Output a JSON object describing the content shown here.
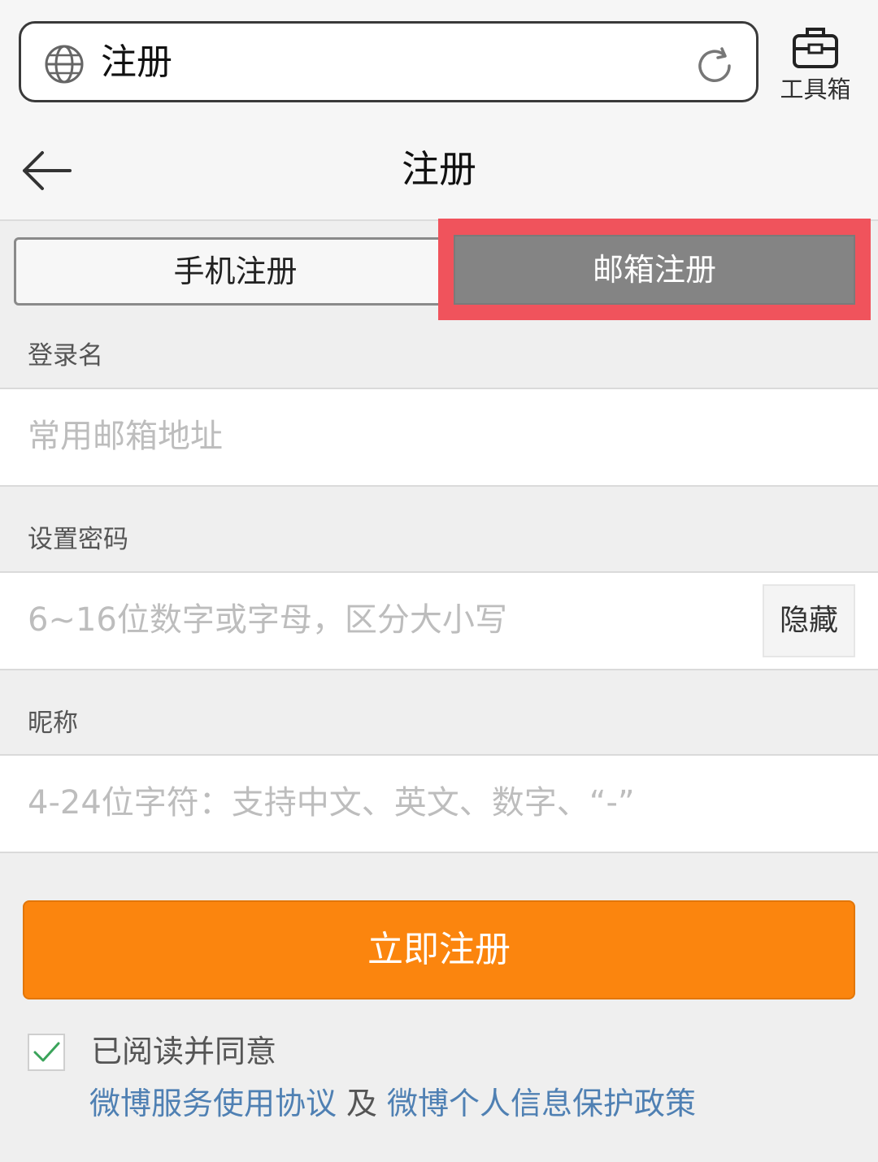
{
  "browser": {
    "url_text": "注册",
    "toolbox_label": "工具箱",
    "icons": [
      "globe-icon",
      "refresh-icon",
      "toolbox-icon"
    ]
  },
  "nav": {
    "title": "注册",
    "back_icon": "arrow-left-icon"
  },
  "tabs": [
    {
      "label": "手机注册",
      "active": false
    },
    {
      "label": "邮箱注册",
      "active": true
    }
  ],
  "form": {
    "login_label": "登录名",
    "login_placeholder": "常用邮箱地址",
    "password_label": "设置密码",
    "password_placeholder": "6~16位数字或字母，区分大小写",
    "password_toggle": "隐藏",
    "nickname_label": "昵称",
    "nickname_placeholder": "4-24位字符：支持中文、英文、数字、“-”"
  },
  "submit_label": "立即注册",
  "agreement": {
    "checked": true,
    "text": "已阅读并同意",
    "link1": "微博服务使用协议",
    "and": "及",
    "link2": "微博个人信息保护政策"
  },
  "colors": {
    "accent": "#fb850e",
    "link": "#4f80b3",
    "highlight": "#f0535c",
    "check": "#3aa35a"
  }
}
